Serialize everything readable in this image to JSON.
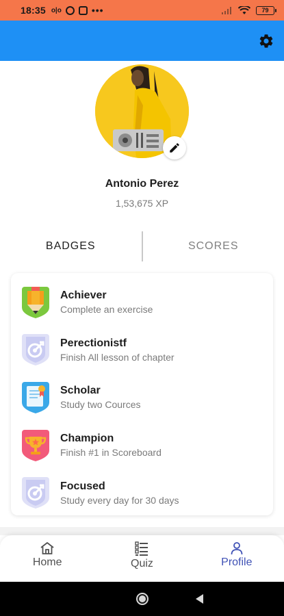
{
  "status_bar": {
    "time": "18:35",
    "battery_level": "79",
    "icons_left": [
      "vibrate-icon",
      "whatsapp-icon",
      "gallery-icon",
      "more-dots-icon"
    ],
    "icons_right": [
      "signal-icon",
      "wifi-icon",
      "battery-icon"
    ]
  },
  "app_bar": {
    "color": "#1e90f5",
    "action_icon": "gear-icon"
  },
  "profile": {
    "name": "Antonio Perez",
    "xp": "1,53,675 XP",
    "edit_icon": "pencil-icon"
  },
  "tabs": [
    {
      "label": "BADGES",
      "active": true
    },
    {
      "label": "SCORES",
      "active": false
    }
  ],
  "badges": [
    {
      "title": "Achiever",
      "description": "Complete an exercise",
      "icon": "pencil-shield-icon"
    },
    {
      "title": "Perectionistf",
      "description": "Finish All lesson of chapter",
      "icon": "target-shield-icon"
    },
    {
      "title": "Scholar",
      "description": "Study two Cources",
      "icon": "certificate-shield-icon"
    },
    {
      "title": "Champion",
      "description": "Finish #1 in Scoreboard",
      "icon": "trophy-shield-icon"
    },
    {
      "title": "Focused",
      "description": "Study every day for 30 days",
      "icon": "target-shield-icon"
    }
  ],
  "bottom_nav": [
    {
      "label": "Home",
      "icon": "home-icon",
      "active": false
    },
    {
      "label": "Quiz",
      "icon": "list-icon",
      "active": false
    },
    {
      "label": "Profile",
      "icon": "person-icon",
      "active": true
    }
  ],
  "colors": {
    "status_bar": "#f5764a",
    "app_bar": "#1e90f5",
    "nav_active": "#3f51b5",
    "avatar_bg": "#f7c81e"
  }
}
